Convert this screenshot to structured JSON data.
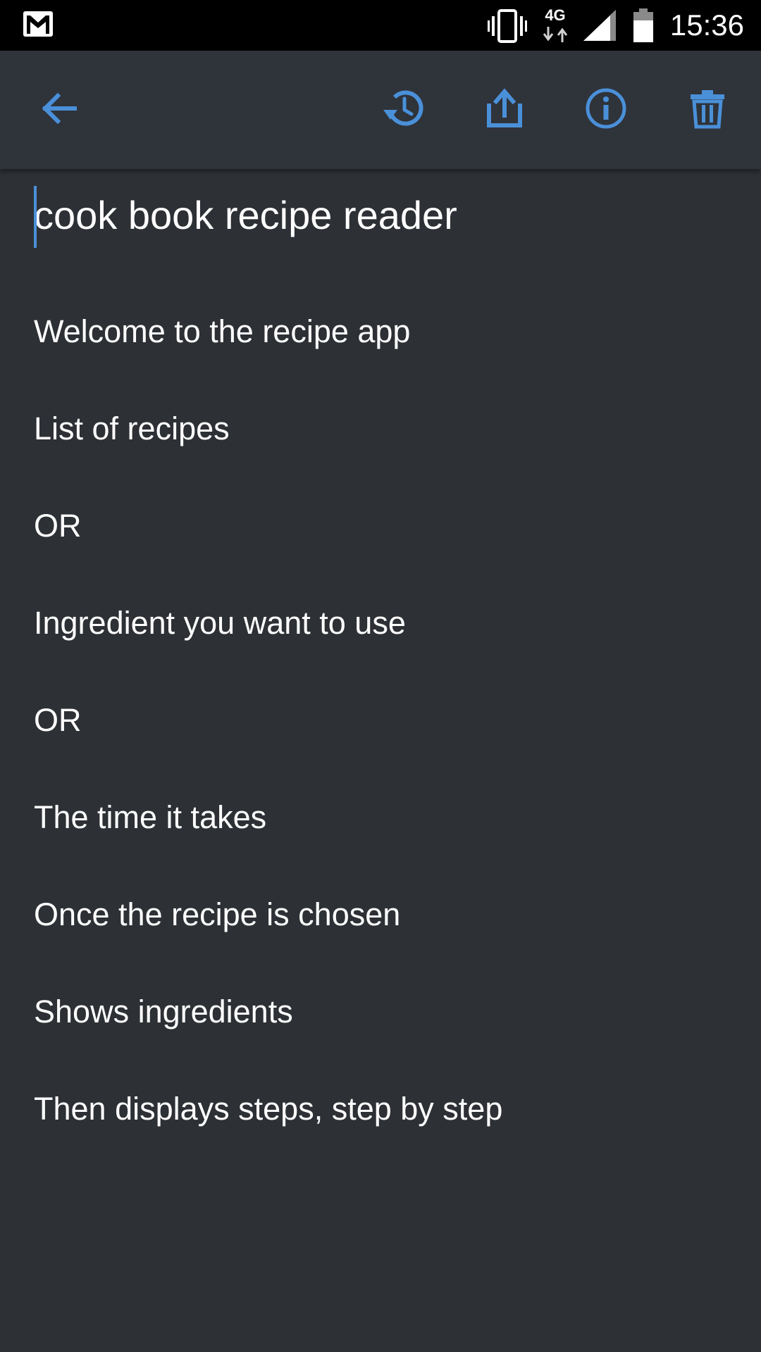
{
  "status_bar": {
    "network_type": "4G",
    "time": "15:36",
    "icons": [
      "gmail-icon",
      "vibrate-icon",
      "network-arrows-icon",
      "signal-icon",
      "battery-icon"
    ]
  },
  "toolbar": {
    "icons": [
      "back-arrow-icon",
      "history-icon",
      "share-icon",
      "info-icon",
      "delete-icon"
    ],
    "accent_color": "#4a90d9"
  },
  "note": {
    "title": "cook book recipe reader",
    "lines": [
      "Welcome to the recipe app",
      "List of recipes",
      "OR",
      "Ingredient you want to use",
      "OR",
      "The time it takes",
      "Once the recipe is chosen",
      "Shows ingredients",
      "Then displays steps, step by step"
    ]
  },
  "colors": {
    "background": "#2d3035",
    "toolbar": "#2f333a",
    "status_bar": "#000000",
    "text": "#ffffff",
    "accent": "#4a90d9"
  }
}
